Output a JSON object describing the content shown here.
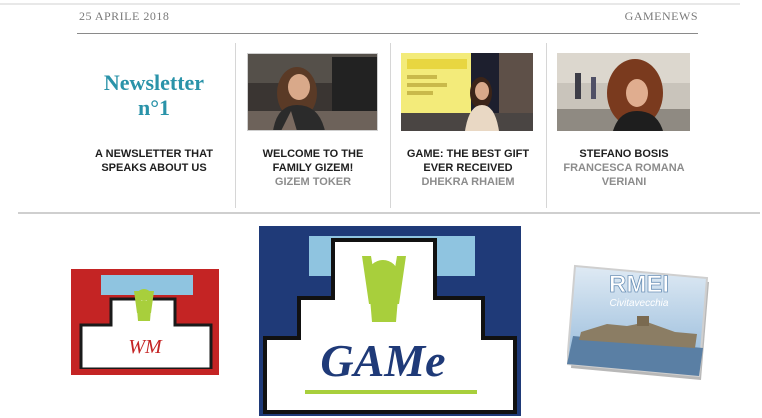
{
  "header": {
    "date": "25 APRILE 2018",
    "brand": "GAMENEWS"
  },
  "newsletter": {
    "title_line1": "Newsletter",
    "title_line2": "n°1",
    "subtitle": "A NEWSLETTER THAT SPEAKS ABOUT US"
  },
  "articles": [
    {
      "title": "WELCOME TO THE FAMILY GIZEM!",
      "author": "GIZEM TOKER"
    },
    {
      "title": "GAME: THE BEST GIFT EVER RECEIVED",
      "author": "DHEKRA RHAIEM"
    },
    {
      "title": "STEFANO BOSIS",
      "author": "FRANCESCA ROMANA VERIANI"
    }
  ],
  "logos": {
    "wm": "WM",
    "game": "GAMe",
    "rmei_title": "RMEI",
    "rmei_sub": "Civitavecchia"
  },
  "colors": {
    "accent": "#2a93a9",
    "game_blue": "#1f3a78",
    "game_green": "#a8cf3c",
    "wm_red": "#c42424"
  }
}
